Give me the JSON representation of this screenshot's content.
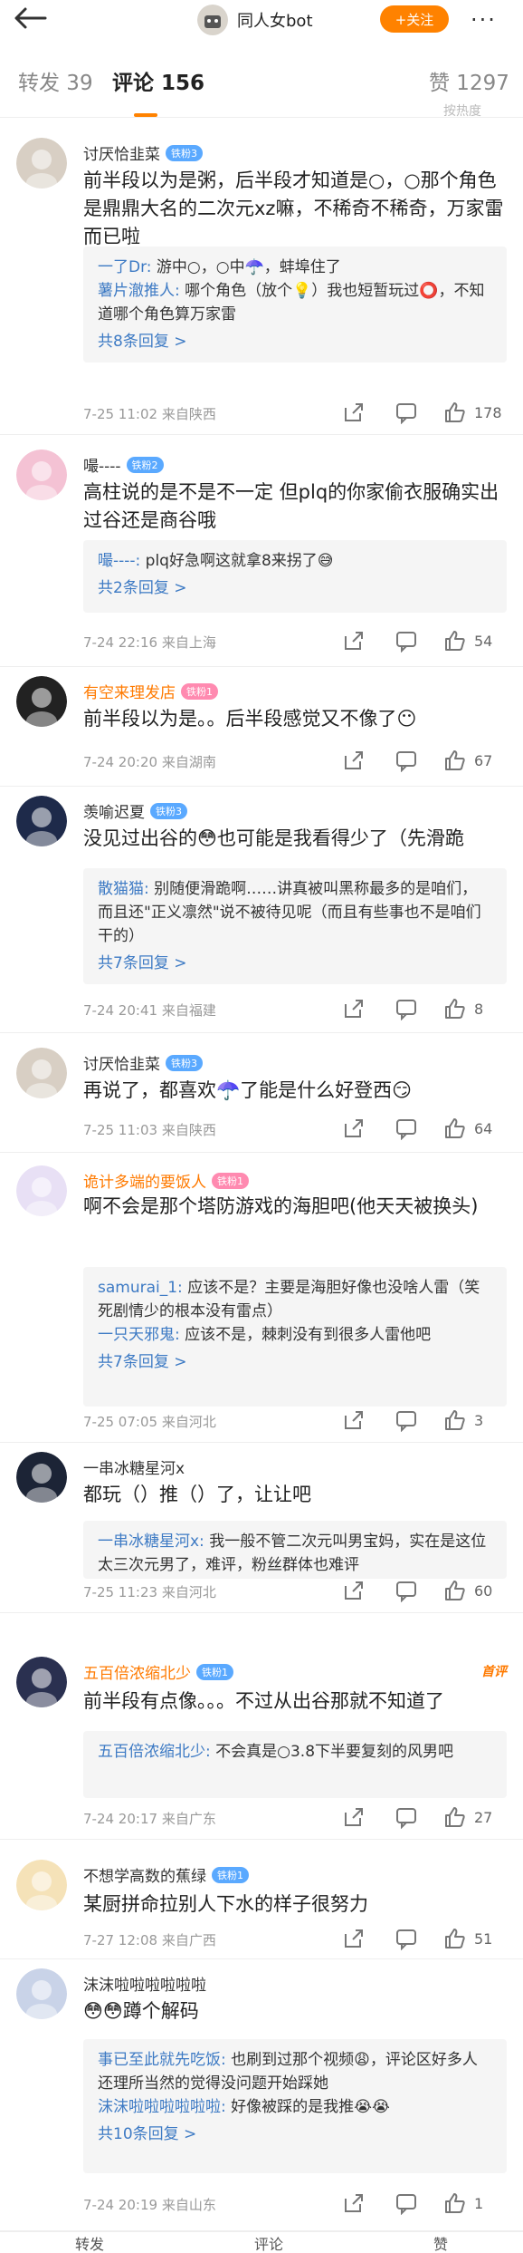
{
  "header": {
    "account_name": "同人女bot",
    "follow_label": "+关注",
    "more_label": "···"
  },
  "tabs": [
    {
      "label": "转发 39"
    },
    {
      "label": "评论 156"
    },
    {
      "label": "赞 1297"
    }
  ],
  "top_fade_text": "按热度",
  "comments": [
    {
      "user": "讨厌恰韭菜",
      "badge": "铁粉3",
      "badge_color": "blue",
      "name_color": "normal",
      "text": "前半段以为是粥，后半段才知道是○，○那个角色是鼎鼎大名的二次元xz嘛，不稀奇不稀奇，万家雷而已啦",
      "replies": [
        {
          "name": "一了Dr:",
          "text": " 游中○，○中☂️，蚌埠住了"
        },
        {
          "name": "薯片澈推人:",
          "text": " 哪个角色（放个💡）我也短暂玩过⭕，不知道哪个角色算万家雷"
        }
      ],
      "more": "共8条回复 >",
      "time": "7-25 11:02",
      "location": "来自陕西",
      "likes": "178"
    },
    {
      "user": "嘬----",
      "badge": "铁粉2",
      "badge_color": "blue",
      "name_color": "normal",
      "text": "高柱说的是不是不一定 但plq的你家偷衣服确实出过谷还是商谷哦",
      "replies": [
        {
          "name": "嘬----:",
          "text": " plq好急啊这就拿8来拐了😅"
        }
      ],
      "more": "共2条回复 >",
      "time": "7-24 22:16",
      "location": "来自上海",
      "likes": "54"
    },
    {
      "user": "有空来理发店",
      "badge": "铁粉1",
      "badge_color": "pink",
      "name_color": "orange",
      "text": "前半段以为是。。后半段感觉又不像了😶",
      "replies": [],
      "more": "",
      "time": "7-24 20:20",
      "location": "来自湖南",
      "likes": "67"
    },
    {
      "user": "羡喻迟夏",
      "badge": "铁粉3",
      "badge_color": "blue",
      "name_color": "normal",
      "text": "没见过出谷的😳也可能是我看得少了（先滑跪",
      "replies": [
        {
          "name": "散猫猫:",
          "text": " 别随便滑跪啊……讲真被叫黑称最多的是咱们，而且还\"正义凛然\"说不被待见呢（而且有些事也不是咱们干的）"
        }
      ],
      "more": "共7条回复 >",
      "time": "7-24 20:41",
      "location": "来自福建",
      "likes": "8"
    },
    {
      "user": "讨厌恰韭菜",
      "badge": "铁粉3",
      "badge_color": "blue",
      "name_color": "normal",
      "text": "再说了，都喜欢☂️了能是什么好登西😏",
      "replies": [],
      "more": "",
      "time": "7-25 11:03",
      "location": "来自陕西",
      "likes": "64"
    },
    {
      "user": "诡计多端的要饭人",
      "badge": "铁粉1",
      "badge_color": "pink",
      "name_color": "orange",
      "text": "啊不会是那个塔防游戏的海胆吧(他天天被换头)",
      "replies": [
        {
          "name": "samurai_1:",
          "text": " 应该不是？主要是海胆好像也没啥人雷（笑死剧情少的根本没有雷点）"
        },
        {
          "name": "一只天邪鬼:",
          "text": " 应该不是，棘刺没有到很多人雷他吧"
        }
      ],
      "more": "共7条回复 >",
      "time": "7-25 07:05",
      "location": "来自河北",
      "likes": "3"
    },
    {
      "user": "一串冰糖星河x",
      "badge": "",
      "badge_color": "blue",
      "name_color": "normal",
      "text": "都玩（）推（）了，让让吧",
      "replies": [
        {
          "name": "一串冰糖星河x:",
          "text": " 我一般不管二次元叫男宝妈，实在是这位太三次元男了，难评，粉丝群体也难评"
        }
      ],
      "more": "",
      "time": "7-25 11:23",
      "location": "来自河北",
      "likes": "60"
    },
    {
      "user": "五百倍浓缩北少",
      "badge": "铁粉1",
      "badge_color": "blue",
      "name_color": "orange",
      "top_tag": "首评",
      "text": "前半段有点像。。。不过从出谷那就不知道了",
      "replies": [
        {
          "name": "五百倍浓缩北少:",
          "text": " 不会真是○3.8下半要复刻的风男吧"
        }
      ],
      "more": "",
      "time": "7-24 20:17",
      "location": "来自广东",
      "likes": "27"
    },
    {
      "user": "不想学高数的蕉绿",
      "badge": "铁粉1",
      "badge_color": "blue",
      "name_color": "normal",
      "text": "某厨拼命拉别人下水的样子很努力",
      "replies": [],
      "more": "",
      "time": "7-27 12:08",
      "location": "来自广西",
      "likes": "51"
    },
    {
      "user": "沫沫啦啦啦啦啦啦",
      "badge": "",
      "badge_color": "blue",
      "name_color": "normal",
      "text": "😳😳蹲个解码",
      "replies": [
        {
          "name": "事已至此就先吃饭:",
          "text": " 也刷到过那个视频😩，评论区好多人还理所当然的觉得没问题开始踩她"
        },
        {
          "name": "沫沫啦啦啦啦啦啦:",
          "text": " 好像被踩的是我推😭😭"
        }
      ],
      "more": "共10条回复 >",
      "time": "7-24 20:19",
      "location": "来自山东",
      "likes": "1"
    }
  ],
  "bottom": {
    "repost": "转发",
    "comment": "评论",
    "like": "赞"
  },
  "colors": {
    "accent": "#ff8200",
    "link": "#3d7ac4",
    "badge_blue": "#5aa9ff"
  }
}
